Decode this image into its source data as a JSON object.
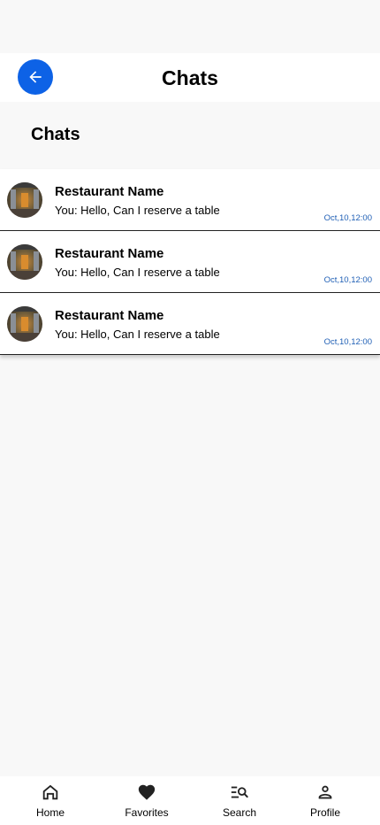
{
  "header": {
    "title": "Chats",
    "back_icon": "arrow-left-icon",
    "accent": "#0d62e6"
  },
  "section": {
    "title": "Chats"
  },
  "chats": [
    {
      "name": "Restaurant Name",
      "message": "You: Hello, Can I reserve a table",
      "time": "Oct,10,12:00"
    },
    {
      "name": "Restaurant Name",
      "message": "You: Hello, Can I reserve a table",
      "time": "Oct,10,12:00"
    },
    {
      "name": "Restaurant Name",
      "message": "You: Hello, Can I reserve a table",
      "time": "Oct,10,12:00"
    }
  ],
  "nav": {
    "items": [
      {
        "label": "Home",
        "icon": "home-icon"
      },
      {
        "label": "Favorites",
        "icon": "heart-icon"
      },
      {
        "label": "Search",
        "icon": "search-icon"
      },
      {
        "label": "Profile",
        "icon": "person-icon"
      }
    ]
  },
  "colors": {
    "time": "#1f5fb5",
    "background": "#f8f8f8"
  }
}
